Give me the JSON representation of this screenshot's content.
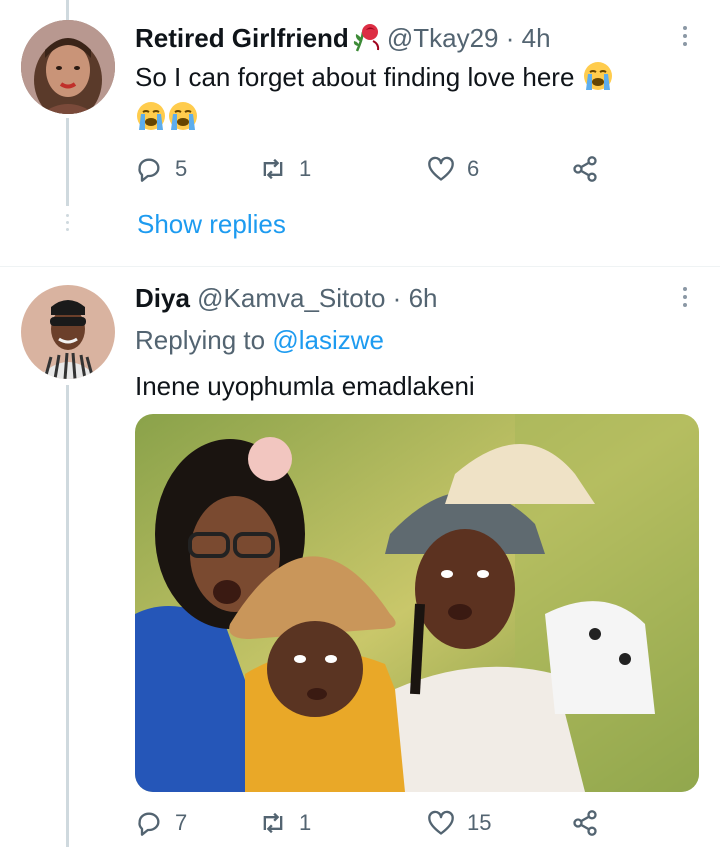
{
  "tweets": [
    {
      "name": "Retired Girlfriend",
      "handle": "@Tkay29",
      "separator": "·",
      "time": "4h",
      "text": "So I can forget about finding love here",
      "name_emoji": "wilted-rose-emoji",
      "text_emojis": [
        "loudly-crying-emoji",
        "loudly-crying-emoji",
        "loudly-crying-emoji"
      ],
      "replies": "5",
      "retweets": "1",
      "likes": "6",
      "show_replies": "Show replies"
    },
    {
      "name": "Diya",
      "handle": "@Kamva_Sitoto",
      "separator": "·",
      "time": "6h",
      "replying_prefix": "Replying to",
      "replying_to": "@lasizwe",
      "text": "Inene uyophumla emadlakeni",
      "replies": "7",
      "retweets": "1",
      "likes": "15"
    }
  ],
  "colors": {
    "accent": "#1d9bf0",
    "secondary_text": "#536471",
    "thread_line": "#cfd9de"
  },
  "icons": [
    "reply-icon",
    "retweet-icon",
    "like-icon",
    "share-icon",
    "more-options-icon"
  ]
}
